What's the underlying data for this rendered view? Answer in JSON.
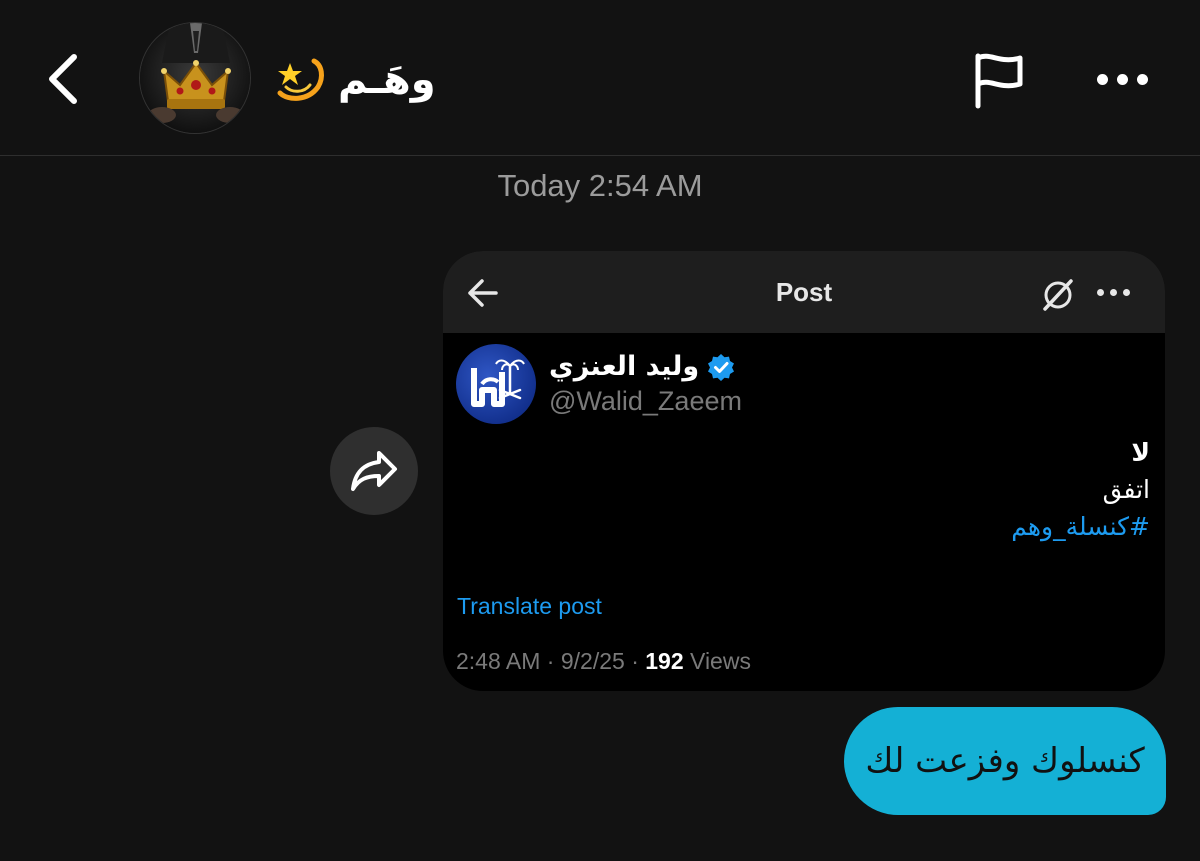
{
  "header": {
    "contact_name": "وهَـم",
    "contact_emoji": "dizzy-star-emoji",
    "avatar": "crown-avatar"
  },
  "timestamp": "Today 2:54 AM",
  "shared_post": {
    "header_title": "Post",
    "author_name": "وليد العنزي",
    "author_handle": "@Walid_Zaeem",
    "verified": true,
    "body_line1": "لا",
    "body_line2": "اتفق",
    "hashtag": "#كنسلة_وهم",
    "translate_label": "Translate post",
    "time": "2:48 AM",
    "date": "9/2/25",
    "views_count": "192",
    "views_label": "Views"
  },
  "message": {
    "text": "كنسلوك وفزعت لك"
  },
  "colors": {
    "background": "#121212",
    "bubble": "#14b0d5",
    "link": "#1d9bf0",
    "card_header": "#1e1e1e"
  }
}
